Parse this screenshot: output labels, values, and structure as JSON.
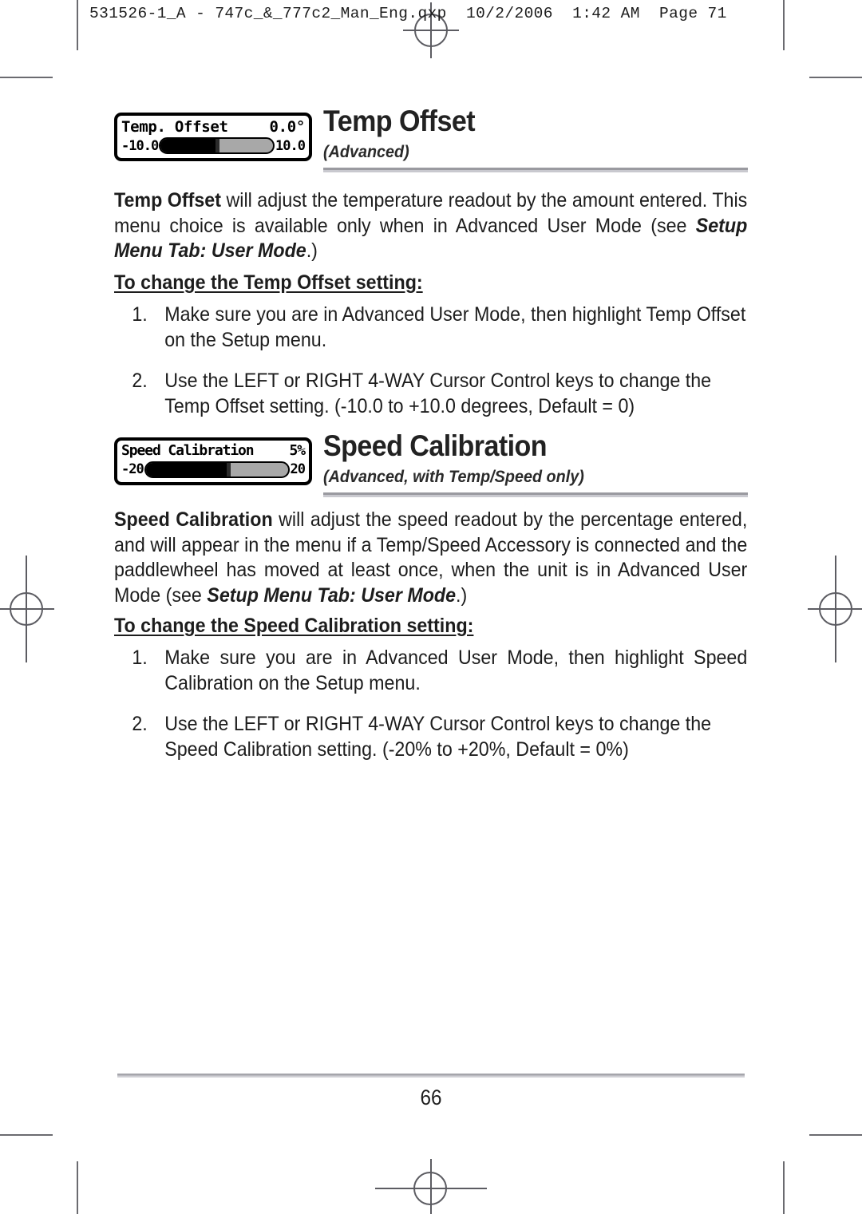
{
  "print_header": "531526-1_A - 747c_&_777c2_Man_Eng.qxp  10/2/2006  1:42 AM  Page 71",
  "page_number": "66",
  "sections": [
    {
      "id": "temp-offset",
      "heading": "Temp Offset",
      "subheading": "(Advanced)",
      "lcd": {
        "title": "Temp. Offset",
        "value": "0.0°",
        "min_label": "-10.0",
        "max_label": "10.0",
        "fill_percent": 50,
        "thumb_percent": 50
      },
      "paragraph": {
        "lead": "Temp Offset",
        "text_1": " will adjust the temperature readout by the amount entered. This menu choice is available only when in Advanced User Mode (see ",
        "emphasis": "Setup Menu Tab: User Mode",
        "text_2": ".)"
      },
      "subhead": "To change the Temp Offset setting:",
      "steps": [
        {
          "num": "1.",
          "text": "Make sure you are in Advanced User Mode, then highlight Temp Offset on the Setup menu.",
          "justify": false
        },
        {
          "num": "2.",
          "text": "Use the LEFT or RIGHT 4-WAY Cursor Control keys to change the Temp Offset setting. (-10.0 to +10.0 degrees, Default = 0)",
          "justify": false
        }
      ]
    },
    {
      "id": "speed-calibration",
      "heading": "Speed Calibration",
      "subheading": "(Advanced, with Temp/Speed only)",
      "lcd": {
        "title": "Speed Calibration",
        "value": "5%",
        "min_label": "-20",
        "max_label": "20",
        "fill_percent": 58,
        "thumb_percent": 58
      },
      "paragraph": {
        "lead": "Speed Calibration",
        "text_1": " will adjust the speed readout by the percentage entered, and will appear in the menu if a Temp/Speed Accessory is connected and the paddlewheel has moved at least once, when the unit is in Advanced User Mode (see ",
        "emphasis": "Setup Menu Tab: User Mode",
        "text_2": ".)"
      },
      "subhead": "To change the Speed Calibration setting:",
      "steps": [
        {
          "num": "1.",
          "text": "Make sure you are in Advanced User Mode, then highlight Speed Calibration on the Setup menu.",
          "justify": true
        },
        {
          "num": "2.",
          "text": "Use the LEFT or RIGHT 4-WAY Cursor Control keys to change the Speed Calibration setting. (-20% to +20%, Default = 0%)",
          "justify": false
        }
      ]
    }
  ],
  "colors": {
    "rule_dark": "#9a9aa0",
    "rule_light": "#c9c9cf",
    "crop_mark": "#5c5c62",
    "lcd_border": "#000000",
    "lcd_track": "#a8a8a8",
    "lcd_fill": "#000000"
  }
}
